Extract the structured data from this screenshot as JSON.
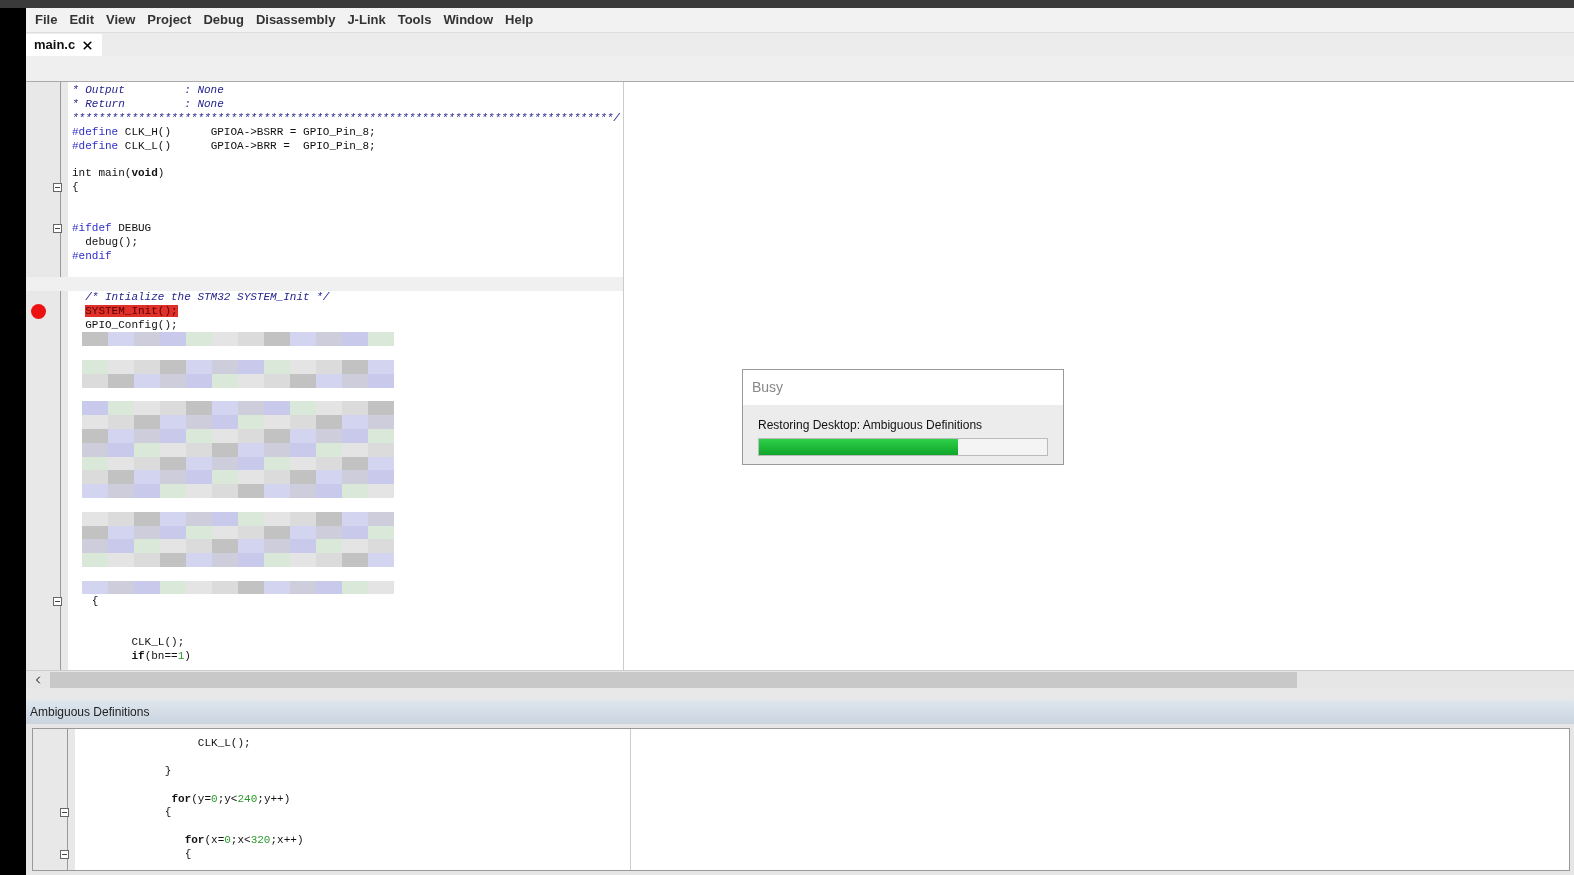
{
  "menu": [
    "File",
    "Edit",
    "View",
    "Project",
    "Debug",
    "Disassembly",
    "J-Link",
    "Tools",
    "Window",
    "Help"
  ],
  "tabs": [
    {
      "label": "main.c",
      "selected": true
    }
  ],
  "editor": {
    "lines": [
      {
        "kind": "code",
        "tokens": [
          {
            "kind": "comment",
            "text": "* Output         : None"
          }
        ]
      },
      {
        "kind": "code",
        "tokens": [
          {
            "kind": "comment",
            "text": "* Return         : None"
          }
        ]
      },
      {
        "kind": "code",
        "tokens": [
          {
            "kind": "comment",
            "text": "**********************************************************************************/"
          }
        ]
      },
      {
        "kind": "code",
        "tokens": [
          {
            "kind": "directive",
            "text": "#define"
          },
          {
            "kind": "plain",
            "text": " CLK_H()      GPIOA->BSRR = GPIO_Pin_8;"
          }
        ]
      },
      {
        "kind": "code",
        "tokens": [
          {
            "kind": "directive",
            "text": "#define"
          },
          {
            "kind": "plain",
            "text": " CLK_L()      GPIOA->BRR =  GPIO_Pin_8;"
          }
        ]
      },
      {
        "kind": "blank"
      },
      {
        "kind": "code",
        "tokens": [
          {
            "kind": "plain",
            "text": "int main("
          },
          {
            "kind": "keyword",
            "text": "void"
          },
          {
            "kind": "plain",
            "text": ")"
          }
        ]
      },
      {
        "kind": "code",
        "fold": true,
        "tokens": [
          {
            "kind": "plain",
            "text": "{"
          }
        ]
      },
      {
        "kind": "blank"
      },
      {
        "kind": "blank"
      },
      {
        "kind": "code",
        "fold": true,
        "tokens": [
          {
            "kind": "directive",
            "text": "#ifdef"
          },
          {
            "kind": "plain",
            "text": " DEBUG"
          }
        ]
      },
      {
        "kind": "code",
        "tokens": [
          {
            "kind": "plain",
            "text": "  debug();"
          }
        ]
      },
      {
        "kind": "code",
        "tokens": [
          {
            "kind": "directive",
            "text": "#endif"
          }
        ]
      },
      {
        "kind": "blank"
      },
      {
        "kind": "blank",
        "current": true
      },
      {
        "kind": "code",
        "tokens": [
          {
            "kind": "comment",
            "text": "  /* Intialize the STM32 SYSTEM_Init */"
          }
        ]
      },
      {
        "kind": "code",
        "breakpoint": true,
        "tokens": [
          {
            "kind": "highlight",
            "text": "  SYSTEM_Init();"
          }
        ]
      },
      {
        "kind": "code",
        "tokens": [
          {
            "kind": "plain",
            "text": "  GPIO_Config();"
          }
        ]
      },
      {
        "kind": "blurred"
      },
      {
        "kind": "blank"
      },
      {
        "kind": "blurred"
      },
      {
        "kind": "blurred"
      },
      {
        "kind": "blank"
      },
      {
        "kind": "blurred"
      },
      {
        "kind": "blurred"
      },
      {
        "kind": "blurred"
      },
      {
        "kind": "blurred"
      },
      {
        "kind": "blurred"
      },
      {
        "kind": "blurred"
      },
      {
        "kind": "blurred"
      },
      {
        "kind": "blank"
      },
      {
        "kind": "blurred"
      },
      {
        "kind": "blurred"
      },
      {
        "kind": "blurred"
      },
      {
        "kind": "blurred"
      },
      {
        "kind": "blank"
      },
      {
        "kind": "blurred"
      },
      {
        "kind": "code",
        "fold": true,
        "tokens": [
          {
            "kind": "plain",
            "text": "   {"
          }
        ]
      },
      {
        "kind": "blank"
      },
      {
        "kind": "blank"
      },
      {
        "kind": "code",
        "tokens": [
          {
            "kind": "plain",
            "text": "         CLK_L();"
          }
        ]
      },
      {
        "kind": "code",
        "tokens": [
          {
            "kind": "keyword",
            "text": "         if"
          },
          {
            "kind": "plain",
            "text": "(bn=="
          },
          {
            "kind": "number",
            "text": "1"
          },
          {
            "kind": "plain",
            "text": ")"
          }
        ]
      }
    ]
  },
  "dialog": {
    "title": "Busy",
    "message": "Restoring Desktop: Ambiguous Definitions",
    "level": 0.69
  },
  "panel": {
    "title": "Ambiguous Definitions",
    "lines": [
      {
        "kind": "code",
        "tokens": [
          {
            "kind": "plain",
            "text": "                  CLK_L();"
          }
        ]
      },
      {
        "kind": "blank"
      },
      {
        "kind": "code",
        "tokens": [
          {
            "kind": "plain",
            "text": "             }"
          }
        ]
      },
      {
        "kind": "blank"
      },
      {
        "kind": "code",
        "tokens": [
          {
            "kind": "keyword",
            "text": "              for"
          },
          {
            "kind": "plain",
            "text": "(y="
          },
          {
            "kind": "number",
            "text": "0"
          },
          {
            "kind": "plain",
            "text": ";y<"
          },
          {
            "kind": "number",
            "text": "240"
          },
          {
            "kind": "plain",
            "text": ";y++)"
          }
        ]
      },
      {
        "kind": "code",
        "fold": true,
        "tokens": [
          {
            "kind": "plain",
            "text": "             {"
          }
        ]
      },
      {
        "kind": "blank"
      },
      {
        "kind": "code",
        "tokens": [
          {
            "kind": "keyword",
            "text": "                for"
          },
          {
            "kind": "plain",
            "text": "(x="
          },
          {
            "kind": "number",
            "text": "0"
          },
          {
            "kind": "plain",
            "text": ";x<"
          },
          {
            "kind": "number",
            "text": "320"
          },
          {
            "kind": "plain",
            "text": ";x++)"
          }
        ]
      },
      {
        "kind": "code",
        "fold": true,
        "tokens": [
          {
            "kind": "plain",
            "text": "                {"
          }
        ]
      }
    ]
  }
}
